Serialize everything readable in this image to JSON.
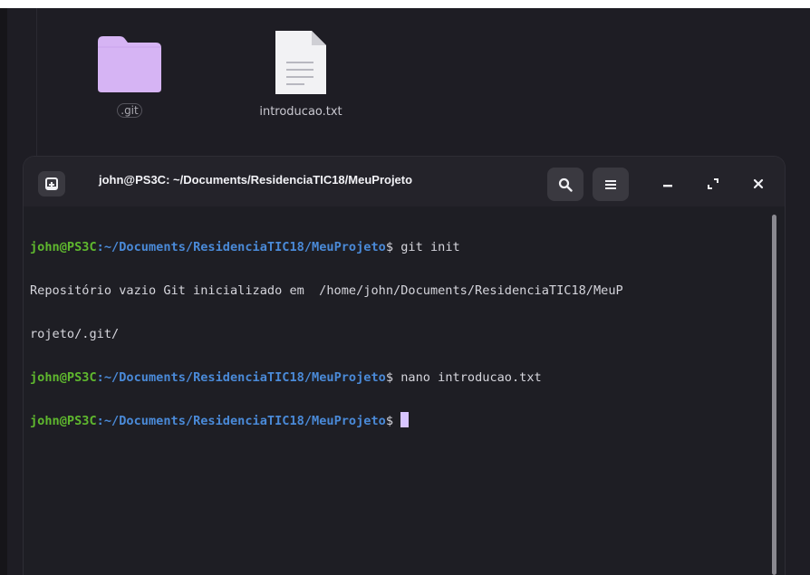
{
  "desktop": {
    "files": [
      {
        "name": ".git",
        "icon": "folder-icon"
      },
      {
        "name": "introducao.txt",
        "icon": "text-file-icon"
      }
    ]
  },
  "terminal": {
    "title": "john@PS3C: ~/Documents/ResidenciaTIC18/MeuProjeto",
    "buttons": {
      "new_tab": "new-tab-icon",
      "search": "search-icon",
      "menu": "hamburger-menu-icon",
      "minimize": "minimize-icon",
      "maximize": "maximize-icon",
      "close": "close-icon"
    },
    "prompt": {
      "user": "john@PS3C",
      "sep": ":",
      "path": "~/Documents/ResidenciaTIC18/MeuProjeto",
      "sym": "$"
    },
    "lines": {
      "cmd1": " git init",
      "out1": "Repositório vazio Git inicializado em  /home/john/Documents/ResidenciaTIC18/MeuP",
      "out2": "rojeto/.git/",
      "cmd2": " nano introducao.txt",
      "cmd3": " "
    }
  },
  "colors": {
    "user": "#5fb82e",
    "path": "#4a8ad8",
    "cursor": "#d7c5ff",
    "folder": "#d6b4f4"
  }
}
